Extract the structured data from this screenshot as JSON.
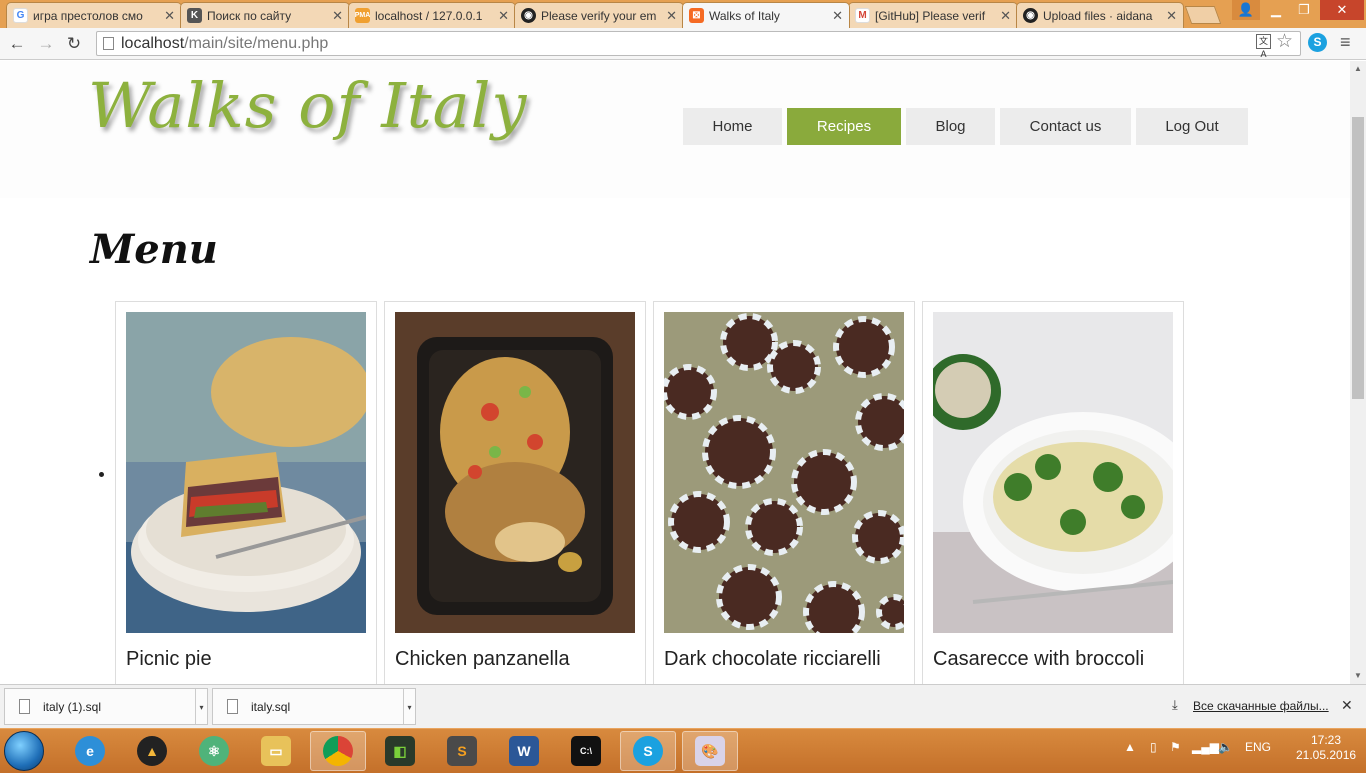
{
  "browser": {
    "tabs": [
      {
        "title": "игра престолов смо",
        "icon": "google-icon"
      },
      {
        "title": "Поиск по сайту",
        "icon": "k-icon"
      },
      {
        "title": "localhost / 127.0.0.1",
        "icon": "phpmyadmin-icon"
      },
      {
        "title": "Please verify your em",
        "icon": "github-icon"
      },
      {
        "title": "Walks of Italy",
        "icon": "xampp-icon"
      },
      {
        "title": "[GitHub] Please verif",
        "icon": "gmail-icon"
      },
      {
        "title": "Upload files · aidana",
        "icon": "github-icon"
      }
    ],
    "url_host": "localhost",
    "url_path": "/main/site/menu.php"
  },
  "site": {
    "logo": "Walks of Italy",
    "nav": [
      "Home",
      "Recipes",
      "Blog",
      "Contact us",
      "Log Out"
    ],
    "active_nav": "Recipes",
    "page_title": "Menu",
    "recipes": [
      {
        "name": "Picnic pie",
        "image": "picnic-pie-photo"
      },
      {
        "name": "Chicken panzanella",
        "image": "chicken-panzanella-photo"
      },
      {
        "name": "Dark chocolate ricciarelli",
        "image": "chocolate-cookies-photo"
      },
      {
        "name": "Casarecce with broccoli",
        "image": "pasta-broccoli-photo"
      }
    ],
    "accent_color": "#8aaa3c"
  },
  "downloads": {
    "items": [
      "italy (1).sql",
      "italy.sql"
    ],
    "show_all": "Все скачанные файлы..."
  },
  "taskbar": {
    "lang": "ENG",
    "time": "17:23",
    "date": "21.05.2016"
  }
}
